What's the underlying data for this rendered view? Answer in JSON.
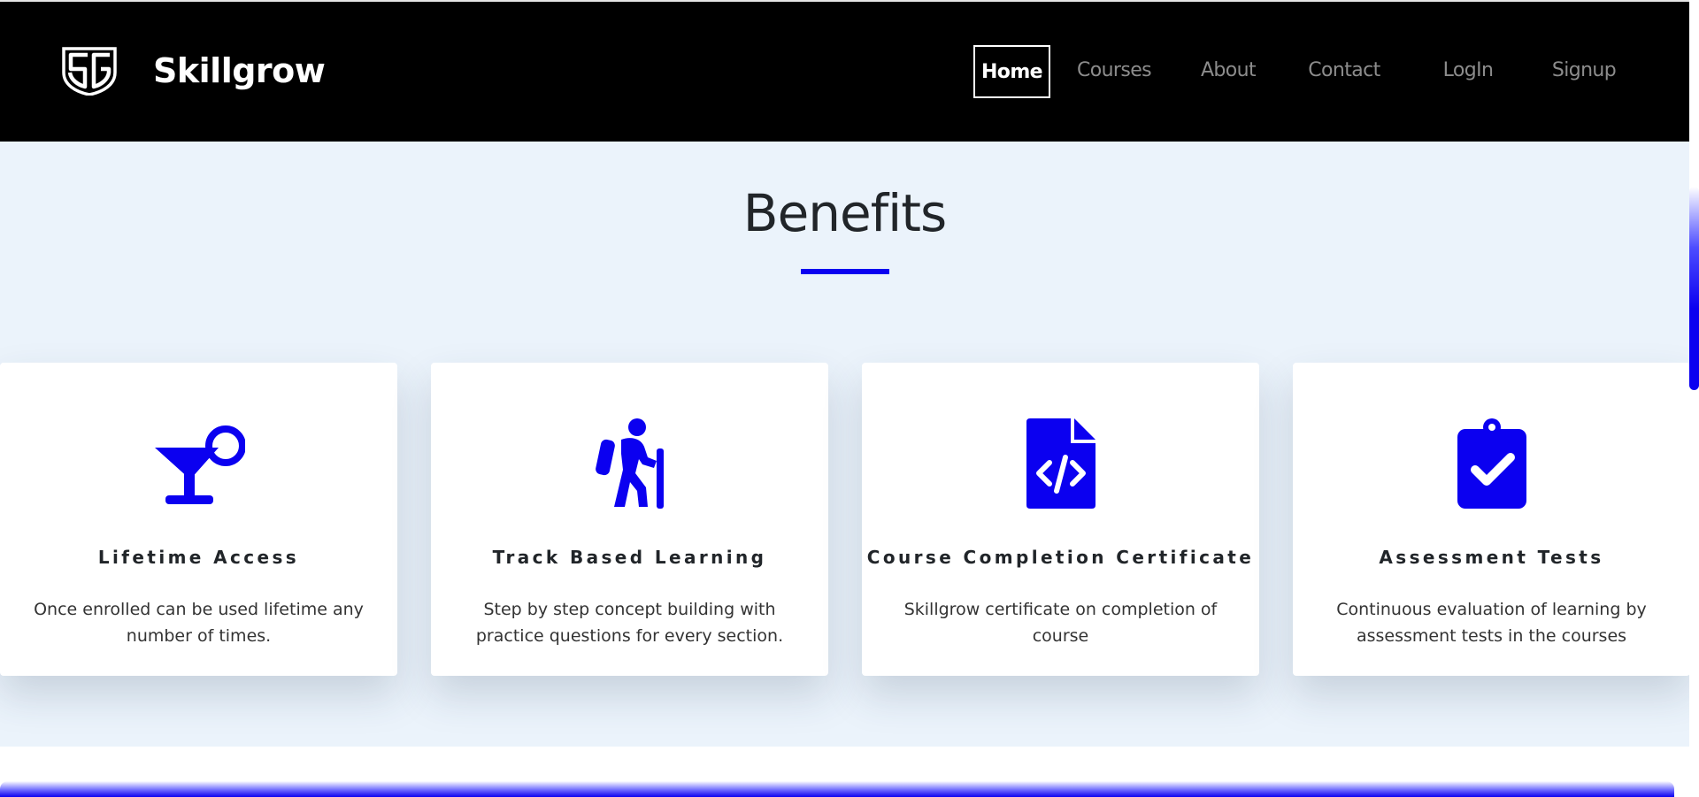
{
  "app": {
    "brand_name": "Skillgrow",
    "logo_icon": "sg-shield-logo-icon"
  },
  "nav": {
    "items": [
      {
        "label": "Home",
        "active": true
      },
      {
        "label": "Courses",
        "active": false
      },
      {
        "label": "About",
        "active": false
      },
      {
        "label": "Contact",
        "active": false
      },
      {
        "label": "LogIn",
        "active": false
      },
      {
        "label": "Signup",
        "active": false
      }
    ]
  },
  "benefits": {
    "title": "Benefits",
    "cards": [
      {
        "icon": "cocktail-glass-icon",
        "title": "Lifetime Access",
        "text": "Once enrolled can be used lifetime any number of times."
      },
      {
        "icon": "hiker-icon",
        "title": "Track Based Learning",
        "text": "Step by step concept building with practice questions for every section."
      },
      {
        "icon": "file-code-icon",
        "title": "Course Completion Certificate",
        "text": "Skillgrow certificate on completion of course"
      },
      {
        "icon": "clipboard-check-icon",
        "title": "Assessment Tests",
        "text": "Continuous evaluation of learning by assessment tests in the courses"
      }
    ]
  },
  "colors": {
    "accent": "#0b00f0",
    "navbar_bg": "#000000",
    "section_bg": "#ebf3fb",
    "nav_inactive": "#8c8c8c"
  }
}
